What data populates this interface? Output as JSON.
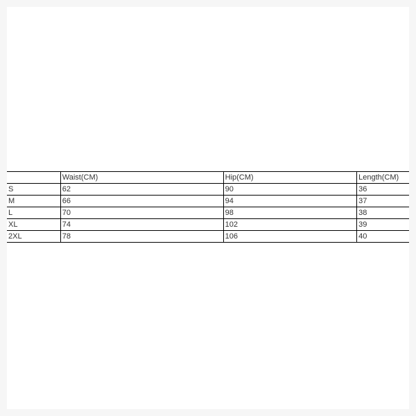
{
  "table": {
    "headers": {
      "size": "",
      "waist": "Waist(CM)",
      "hip": "Hip(CM)",
      "length": "Length(CM)"
    },
    "rows": [
      {
        "size": "S",
        "waist": "62",
        "hip": "90",
        "length": "36"
      },
      {
        "size": "M",
        "waist": "66",
        "hip": "94",
        "length": "37"
      },
      {
        "size": "L",
        "waist": "70",
        "hip": "98",
        "length": "38"
      },
      {
        "size": "XL",
        "waist": "74",
        "hip": "102",
        "length": "39"
      },
      {
        "size": "2XL",
        "waist": "78",
        "hip": "106",
        "length": "40"
      }
    ]
  }
}
